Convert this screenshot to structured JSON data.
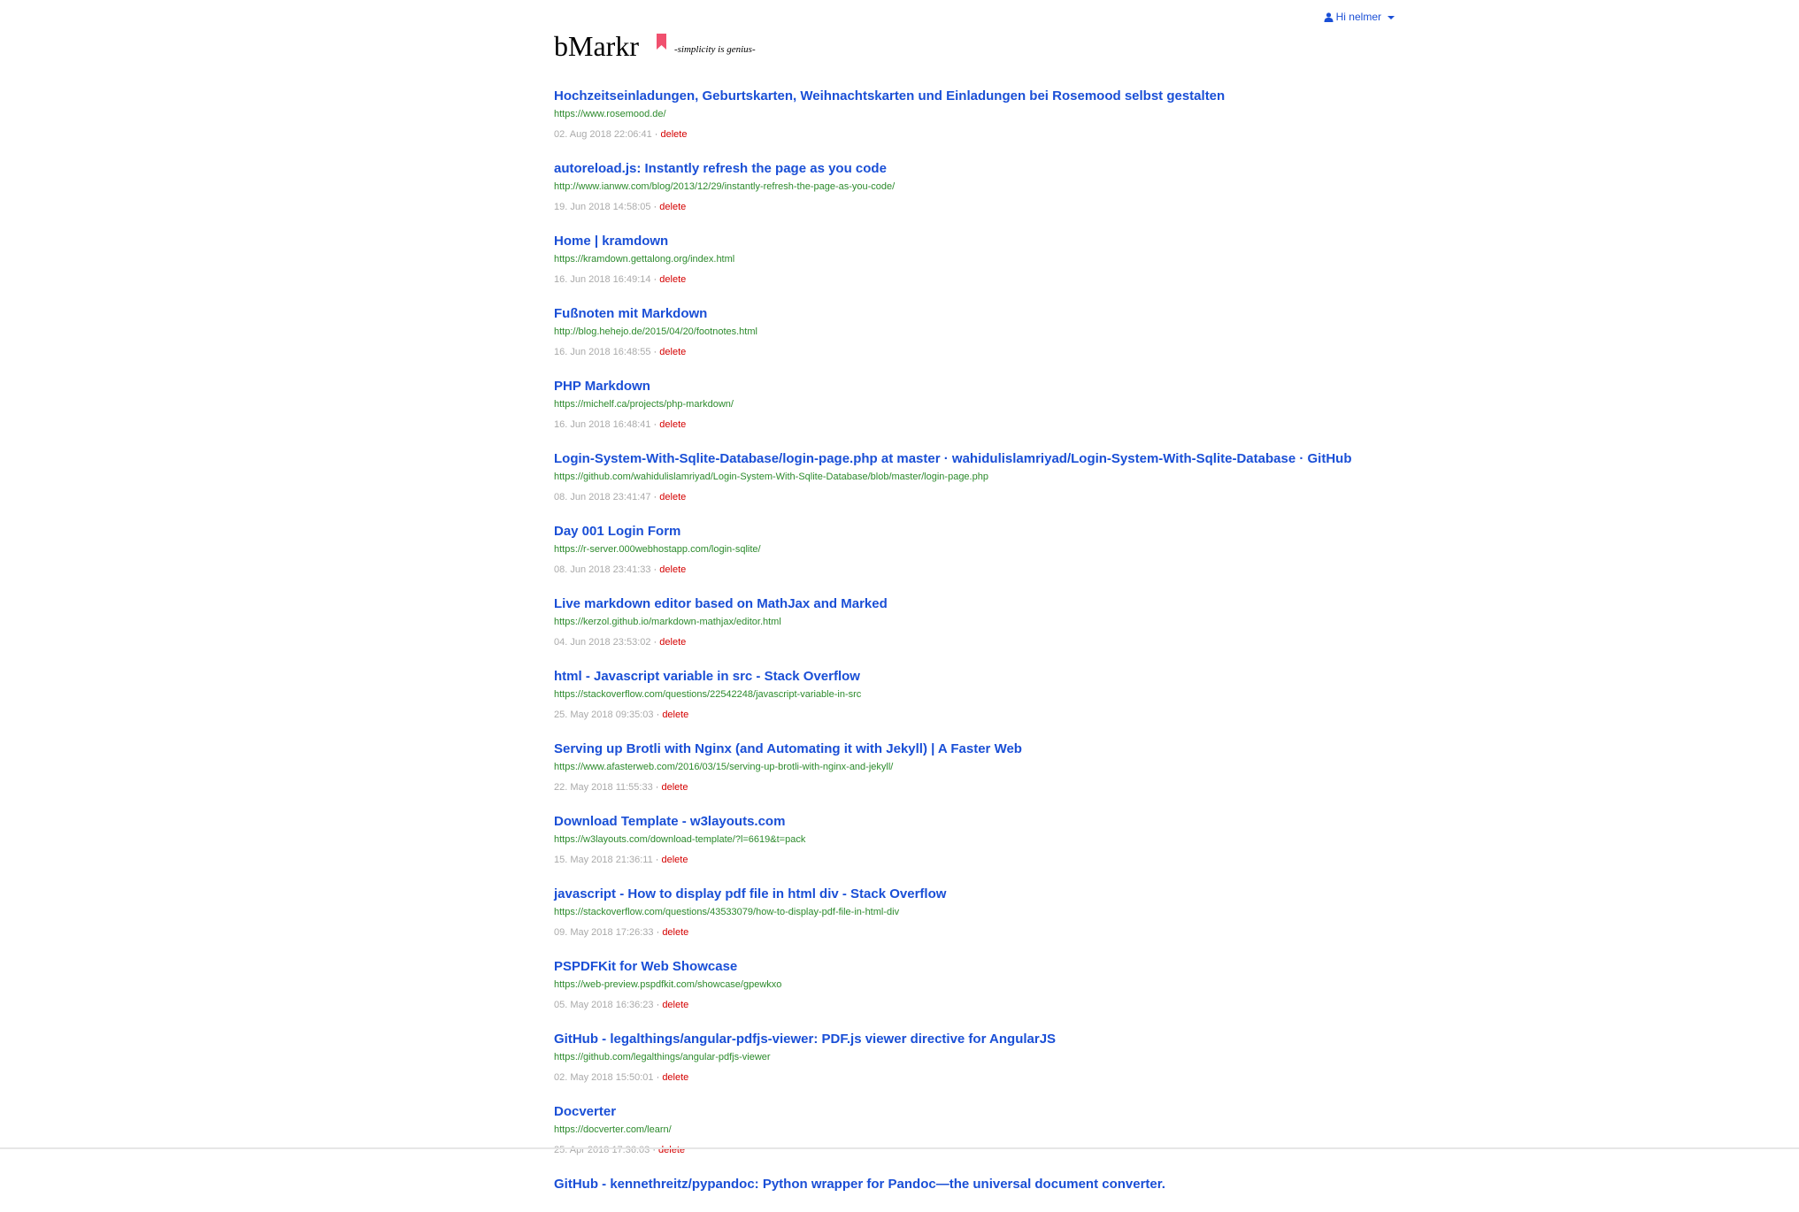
{
  "header": {
    "user_label": "Hi nelmer",
    "brand": "bMarkr",
    "tagline": "-simplicity is genius-",
    "accent_color": "#f0506e",
    "link_color": "#1a4fd6",
    "url_color": "#2c8a2c",
    "delete_color": "#d40000"
  },
  "bookmarks": [
    {
      "title": "Hochzeitseinladungen, Geburtskarten, Weihnachtskarten und Einladungen bei Rosemood selbst gestalten",
      "url": "https://www.rosemood.de/",
      "date": "02. Aug 2018 22:06:41",
      "delete": "delete"
    },
    {
      "title": "autoreload.js: Instantly refresh the page as you code",
      "url": "http://www.ianww.com/blog/2013/12/29/instantly-refresh-the-page-as-you-code/",
      "date": "19. Jun 2018 14:58:05",
      "delete": "delete"
    },
    {
      "title": "Home | kramdown",
      "url": "https://kramdown.gettalong.org/index.html",
      "date": "16. Jun 2018 16:49:14",
      "delete": "delete"
    },
    {
      "title": "Fußnoten mit Markdown",
      "url": "http://blog.hehejo.de/2015/04/20/footnotes.html",
      "date": "16. Jun 2018 16:48:55",
      "delete": "delete"
    },
    {
      "title": "PHP Markdown",
      "url": "https://michelf.ca/projects/php-markdown/",
      "date": "16. Jun 2018 16:48:41",
      "delete": "delete"
    },
    {
      "title": "Login-System-With-Sqlite-Database/login-page.php at master · wahidulislamriyad/Login-System-With-Sqlite-Database · GitHub",
      "url": "https://github.com/wahidulislamriyad/Login-System-With-Sqlite-Database/blob/master/login-page.php",
      "date": "08. Jun 2018 23:41:47",
      "delete": "delete"
    },
    {
      "title": "Day 001 Login Form",
      "url": "https://r-server.000webhostapp.com/login-sqlite/",
      "date": "08. Jun 2018 23:41:33",
      "delete": "delete"
    },
    {
      "title": "Live markdown editor based on MathJax and Marked",
      "url": "https://kerzol.github.io/markdown-mathjax/editor.html",
      "date": "04. Jun 2018 23:53:02",
      "delete": "delete"
    },
    {
      "title": "html - Javascript variable in src - Stack Overflow",
      "url": "https://stackoverflow.com/questions/22542248/javascript-variable-in-src",
      "date": "25. May 2018 09:35:03",
      "delete": "delete"
    },
    {
      "title": "Serving up Brotli with Nginx (and Automating it with Jekyll) | A Faster Web",
      "url": "https://www.afasterweb.com/2016/03/15/serving-up-brotli-with-nginx-and-jekyll/",
      "date": "22. May 2018 11:55:33",
      "delete": "delete"
    },
    {
      "title": "Download Template - w3layouts.com",
      "url": "https://w3layouts.com/download-template/?l=6619&t=pack",
      "date": "15. May 2018 21:36:11",
      "delete": "delete"
    },
    {
      "title": "javascript - How to display pdf file in html div - Stack Overflow",
      "url": "https://stackoverflow.com/questions/43533079/how-to-display-pdf-file-in-html-div",
      "date": "09. May 2018 17:26:33",
      "delete": "delete"
    },
    {
      "title": "PSPDFKit for Web Showcase",
      "url": "https://web-preview.pspdfkit.com/showcase/gpewkxo",
      "date": "05. May 2018 16:36:23",
      "delete": "delete"
    },
    {
      "title": "GitHub - legalthings/angular-pdfjs-viewer: PDF.js viewer directive for AngularJS",
      "url": "https://github.com/legalthings/angular-pdfjs-viewer",
      "date": "02. May 2018 15:50:01",
      "delete": "delete"
    },
    {
      "title": "Docverter",
      "url": "https://docverter.com/learn/",
      "date": "25. Apr 2018 17:36:03",
      "delete": "delete"
    },
    {
      "title": "GitHub - kennethreitz/pypandoc: Python wrapper for Pandoc—the universal document converter.",
      "url": "",
      "date": "",
      "delete": ""
    }
  ]
}
